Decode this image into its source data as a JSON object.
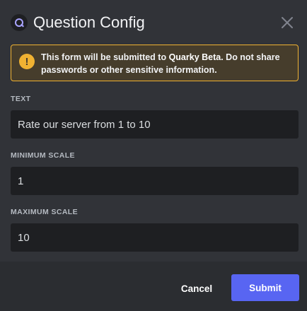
{
  "header": {
    "title": "Question Config",
    "app_icon": "quarky-app-icon",
    "close_icon": "close-icon"
  },
  "notice": {
    "icon": "warning-icon",
    "icon_glyph": "!",
    "text_before": "This form will be submitted to ",
    "app_name": "Quarky Beta",
    "text_after": ". Do not share passwords or other sensitive information.",
    "border_color": "#f0b232"
  },
  "fields": {
    "text": {
      "label": "TEXT",
      "value": "Rate our server from 1 to 10"
    },
    "minimum_scale": {
      "label": "MINIMUM SCALE",
      "value": "1"
    },
    "maximum_scale": {
      "label": "MAXIMUM SCALE",
      "value": "10"
    }
  },
  "footer": {
    "cancel_label": "Cancel",
    "submit_label": "Submit",
    "submit_color": "#5865f2"
  }
}
